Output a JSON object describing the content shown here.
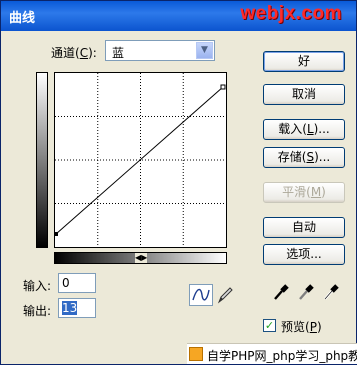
{
  "window": {
    "title": "曲线",
    "watermark": "webjx.com"
  },
  "channel": {
    "label_prefix": "通道(",
    "label_key": "C",
    "label_suffix": "):",
    "value": "蓝"
  },
  "inputs": {
    "input_label": "输入:",
    "input_value": "0",
    "output_label": "输出:",
    "output_value": "13"
  },
  "buttons": {
    "ok": "好",
    "cancel": "取消",
    "load_prefix": "载入(",
    "load_key": "L",
    "load_suffix": ")...",
    "save_prefix": "存储(",
    "save_key": "S",
    "save_suffix": ")...",
    "smooth_prefix": "平滑(",
    "smooth_key": "M",
    "smooth_suffix": ")",
    "auto": "自动",
    "options": "选项..."
  },
  "preview": {
    "label_prefix": "预览(",
    "label_key": "P",
    "label_suffix": ")",
    "checked": true
  },
  "footer": {
    "text": "自学PHP网_php学习_php教"
  },
  "icons": {
    "dropdown": "chevron-down-icon",
    "curve_tool": "curve-tool-icon",
    "pencil_tool": "pencil-icon",
    "eyedroppers": [
      "black-eyedropper-icon",
      "gray-eyedropper-icon",
      "white-eyedropper-icon"
    ]
  },
  "colors": {
    "title_bar": "#0a5ad8",
    "watermark": "#ff2a2a",
    "window_bg": "#ece9d8"
  }
}
